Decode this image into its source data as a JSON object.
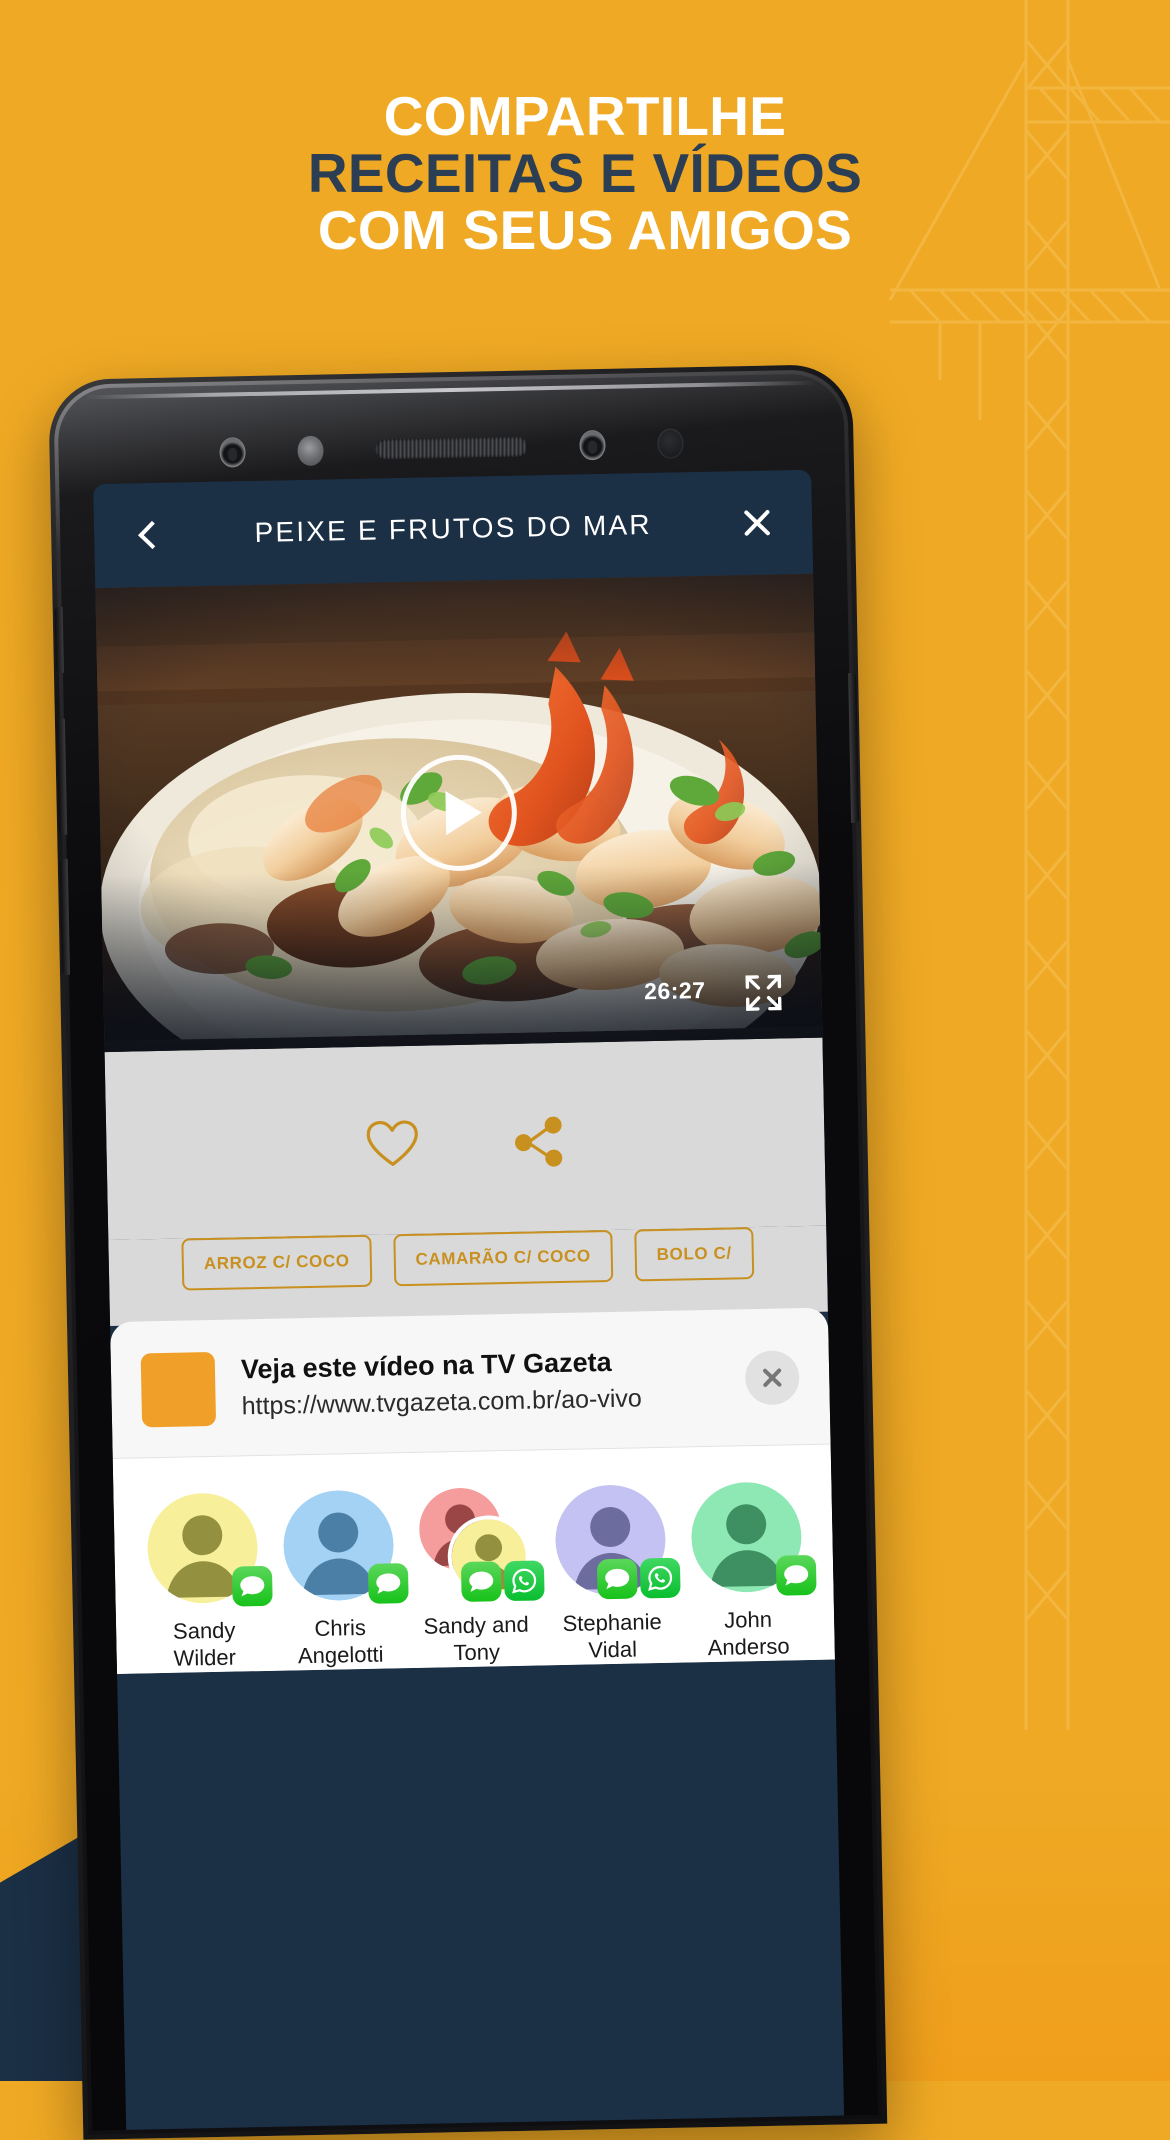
{
  "promo": {
    "headline_line1": "COMPARTILHE",
    "headline_line2": "RECEITAS E VÍDEOS",
    "headline_line3": "COM SEUS AMIGOS",
    "bg_color": "#EFA924",
    "navy_color": "#1B2F45",
    "accent_color": "#C8901F"
  },
  "app": {
    "header": {
      "back_icon": "back-chevron-icon",
      "title": "PEIXE E FRUTOS DO MAR",
      "close_icon": "close-icon"
    },
    "video": {
      "play_icon": "play-icon",
      "duration": "26:27",
      "fullscreen_icon": "fullscreen-icon",
      "alt": "shrimp-and-grits-dish"
    },
    "actions": {
      "favorite_icon": "heart-icon",
      "share_icon": "share-icon"
    },
    "tags": [
      {
        "label": "ARROZ C/ COCO"
      },
      {
        "label": "CAMARÃO C/ COCO"
      },
      {
        "label": "BOLO C/"
      }
    ],
    "share_sheet": {
      "link_title": "Veja este vídeo na TV Gazeta",
      "link_url": "https://www.tvgazeta.com.br/ao-vivo",
      "link_thumb_color": "#F0A029",
      "dismiss_icon": "close-icon",
      "contacts": [
        {
          "name_line1": "Sandy",
          "name_line2": "Wilder",
          "avatar_bg": "#F7EF9A",
          "avatar_fg": "#93913F",
          "badges": [
            "messages-icon"
          ],
          "group": false
        },
        {
          "name_line1": "Chris",
          "name_line2": "Angelotti",
          "avatar_bg": "#A3D2F5",
          "avatar_fg": "#4B7FA5",
          "badges": [
            "messages-icon"
          ],
          "group": false
        },
        {
          "name_line1": "Sandy and",
          "name_line2": "Tony",
          "avatar_bg": "#F59C9C",
          "avatar_fg": "#9B4646",
          "avatar2_bg": "#F7EF9A",
          "avatar2_fg": "#93913F",
          "badges": [
            "messages-icon",
            "whatsapp-icon"
          ],
          "group": true
        },
        {
          "name_line1": "Stephanie",
          "name_line2": "Vidal",
          "avatar_bg": "#C4C2F2",
          "avatar_fg": "#6D6C9E",
          "badges": [
            "messages-icon",
            "whatsapp-icon"
          ],
          "group": false
        },
        {
          "name_line1": "John",
          "name_line2": "Anderso",
          "avatar_bg": "#8EE8B4",
          "avatar_fg": "#3E8F62",
          "badges": [
            "messages-icon"
          ],
          "group": false
        }
      ]
    }
  }
}
